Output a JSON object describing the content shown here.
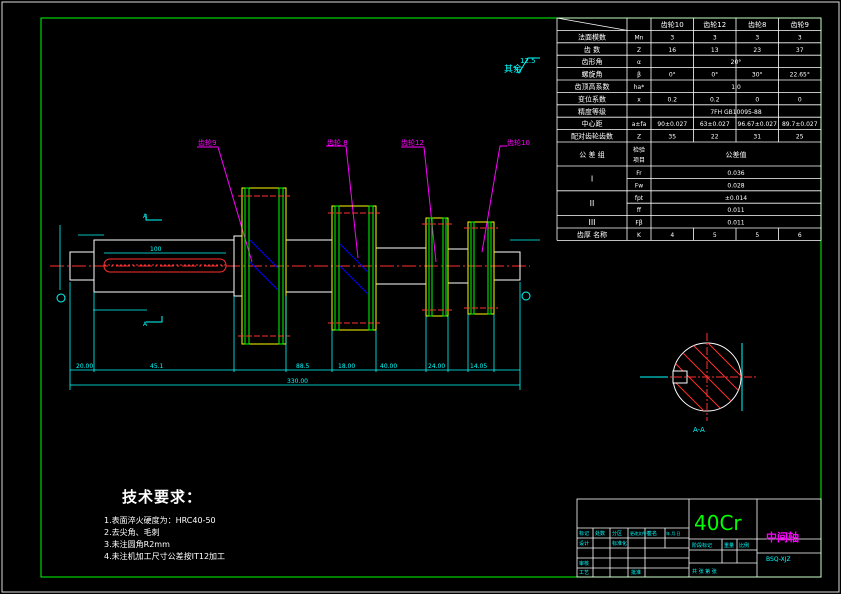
{
  "roughness_other": "其余",
  "roughness_value": "12.5",
  "gear_labels": [
    "齿轮9",
    "齿轮 8",
    "齿轮12",
    "齿轮10"
  ],
  "section_label": "A-A",
  "section_marker": "A",
  "table": {
    "header": [
      "齿轮10",
      "齿轮12",
      "齿轮8",
      "齿轮9"
    ],
    "rows": [
      {
        "name": "法面模数",
        "sym": "Mn",
        "vals": [
          "3",
          "3",
          "3",
          "3"
        ]
      },
      {
        "name": "齿    数",
        "sym": "Z",
        "vals": [
          "16",
          "13",
          "23",
          "37"
        ]
      },
      {
        "name": "齿形角",
        "sym": "α",
        "span": "20°"
      },
      {
        "name": "螺旋角",
        "sym": "β",
        "vals": [
          "0°",
          "0°",
          "30°",
          "22.65°"
        ]
      },
      {
        "name": "齿顶高系数",
        "sym": "ha*",
        "span": "1.0"
      },
      {
        "name": "变位系数",
        "sym": "x",
        "vals": [
          "0.2",
          "0.2",
          "0",
          "0"
        ]
      },
      {
        "name": "精度等级",
        "sym": "",
        "span": "7FH GB10095-88"
      },
      {
        "name": "中心距",
        "sym": "a±fa",
        "vals": [
          "90±0.027",
          "63±0.027",
          "96.67±0.027",
          "89.7±0.027"
        ]
      },
      {
        "name": "配对齿轮齿数",
        "sym": "Z",
        "vals": [
          "35",
          "22",
          "31",
          "25"
        ]
      }
    ],
    "tol_header": {
      "group": "公 差 组",
      "item": "检验项目",
      "value": "公差值"
    },
    "tol_rows": [
      {
        "group": "I",
        "items": [
          {
            "sym": "Fr",
            "val": "0.036"
          },
          {
            "sym": "Fw",
            "val": "0.028"
          }
        ]
      },
      {
        "group": "II",
        "items": [
          {
            "sym": "fpt",
            "val": "±0.014"
          },
          {
            "sym": "ff",
            "val": "0.011"
          }
        ]
      },
      {
        "group": "III",
        "items": [
          {
            "sym": "Fβ",
            "val": "0.011"
          }
        ]
      }
    ],
    "footer": {
      "name": "齿厚  名称",
      "sym": "K",
      "vals": [
        "4",
        "5",
        "5",
        "6"
      ]
    }
  },
  "dims": {
    "total": "330.00",
    "left": "20.00",
    "mid": "45.1",
    "key": "100",
    "d1": "88.5",
    "d2": "18.00",
    "d3": "40.00",
    "d4": "24.00",
    "d5": "14.05"
  },
  "tech": {
    "title": "技术要求：",
    "items": [
      "1.表面淬火硬度为：HRC40-50",
      "2.去尖角、毛刺",
      "3.未注圆角R2mm",
      "4.未注机加工尺寸公差按IT12加工"
    ]
  },
  "title_block": {
    "material": "40Cr",
    "part_name": "中间轴",
    "drawing_no": "BSQ-XJZ",
    "cells": [
      "标记",
      "处数",
      "分区",
      "更改文件号",
      "签名",
      "年.月.日",
      "设计",
      "标准化",
      "审核",
      "工艺",
      "批准",
      "阶段标记",
      "重量",
      "比例",
      "共   张   第   张"
    ]
  }
}
